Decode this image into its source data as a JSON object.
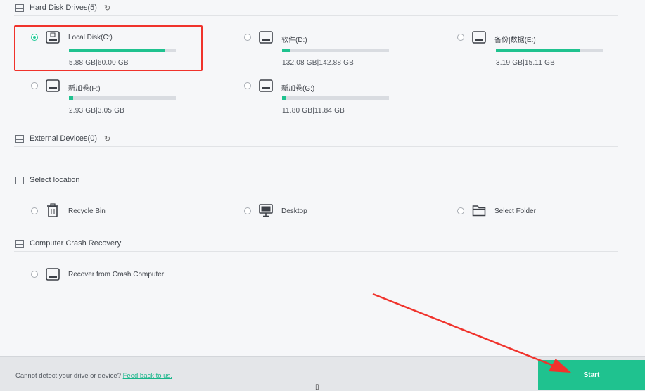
{
  "colors": {
    "accent": "#1fc28f",
    "highlight": "#f0332c"
  },
  "sections": {
    "hdd": {
      "title": "Hard Disk Drives(5)"
    },
    "external": {
      "title": "External Devices(0)"
    },
    "location": {
      "title": "Select location"
    },
    "crash": {
      "title": "Computer Crash Recovery"
    }
  },
  "drives": [
    {
      "label": "Local Disk(C:)",
      "size": "5.88 GB|60.00 GB",
      "fill": 0.9,
      "selected": true
    },
    {
      "label": "软件(D:)",
      "size": "132.08 GB|142.88 GB",
      "fill": 0.07,
      "selected": false
    },
    {
      "label": "备份|数据(E:)",
      "size": "3.19 GB|15.11 GB",
      "fill": 0.78,
      "selected": false
    },
    {
      "label": "新加卷(F:)",
      "size": "2.93 GB|3.05 GB",
      "fill": 0.04,
      "selected": false
    },
    {
      "label": "新加卷(G:)",
      "size": "11.80 GB|11.84 GB",
      "fill": 0.04,
      "selected": false
    }
  ],
  "locations": [
    {
      "label": "Recycle Bin",
      "icon": "trash-icon"
    },
    {
      "label": "Desktop",
      "icon": "monitor-icon"
    },
    {
      "label": "Select Folder",
      "icon": "folder-icon"
    }
  ],
  "crash_item": {
    "label": "Recover from Crash Computer",
    "icon": "drive-icon"
  },
  "footer": {
    "text": "Cannot detect your drive or device?",
    "link": "Feed back to us.",
    "start_label": "Start"
  }
}
